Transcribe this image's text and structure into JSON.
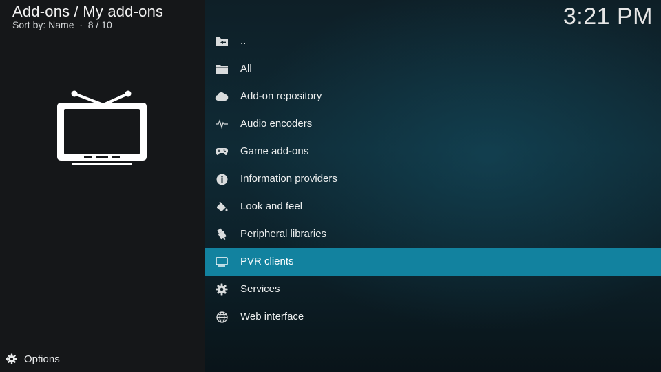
{
  "header": {
    "title": "Add-ons / My add-ons",
    "sort_label": "Sort by: Name",
    "position": "8 / 10"
  },
  "clock": "3:21 PM",
  "preview": {
    "icon": "tv-icon"
  },
  "menu": {
    "items": [
      {
        "label": "..",
        "icon": "back-folder-icon"
      },
      {
        "label": "All",
        "icon": "folder-icon"
      },
      {
        "label": "Add-on repository",
        "icon": "cloud-icon"
      },
      {
        "label": "Audio encoders",
        "icon": "waveform-icon"
      },
      {
        "label": "Game add-ons",
        "icon": "gamepad-icon"
      },
      {
        "label": "Information providers",
        "icon": "info-icon"
      },
      {
        "label": "Look and feel",
        "icon": "paint-bucket-icon"
      },
      {
        "label": "Peripheral libraries",
        "icon": "usb-plug-icon"
      },
      {
        "label": "PVR clients",
        "icon": "tv-icon",
        "selected": true
      },
      {
        "label": "Services",
        "icon": "gear-icon"
      },
      {
        "label": "Web interface",
        "icon": "globe-icon"
      }
    ]
  },
  "footer": {
    "options_label": "Options",
    "icon": "options-icon"
  },
  "colors": {
    "selected": "#12829f",
    "left_panel": "#151719",
    "text": "#e8eaeb"
  }
}
